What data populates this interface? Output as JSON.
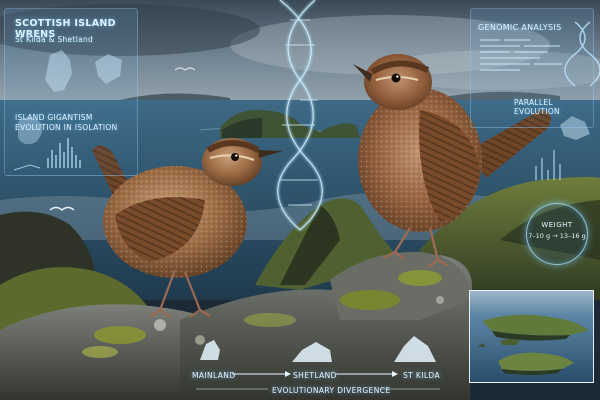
{
  "overlay": {
    "title": "SCOTTISH ISLAND WRENS",
    "subtitle": "St Kilda & Shetland",
    "gigantism_line1": "ISLAND GIGANTISM",
    "gigantism_line2": "EVOLUTION IN ISOLATION",
    "genomic_label": "GENOMIC ANALYSIS",
    "parallel_label": "PARALLEL EVOLUTION",
    "weight_label": "WEIGHT",
    "weight_value": "7–10 g → 13–16 g"
  },
  "divergence": {
    "steps": [
      "MAINLAND",
      "SHETLAND",
      "ST KILDA"
    ],
    "footer": "EVOLUTIONARY DIVERGENCE"
  },
  "palette": {
    "hud_glow": "#9fd8ff",
    "sea": "#34576f",
    "sky": "#5f7384",
    "wren_brown": "#8a5a35",
    "moss": "#6b7a2a"
  }
}
